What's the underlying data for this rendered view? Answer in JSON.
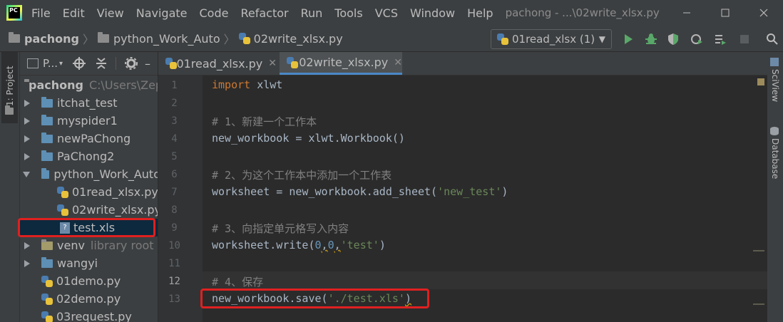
{
  "menubar": {
    "items": [
      "File",
      "Edit",
      "View",
      "Navigate",
      "Code",
      "Refactor",
      "Run",
      "Tools",
      "VCS",
      "Window",
      "Help"
    ],
    "title": "pachong - ...\\02write_xlsx.py"
  },
  "navbar": {
    "crumbs": [
      "pachong",
      "python_Work_Auto",
      "02write_xlsx.py"
    ],
    "run_config": "01read_xlsx (1)"
  },
  "left_strip": {
    "tab_label": "1: Project"
  },
  "right_strip": {
    "tabs": [
      "SciView",
      "Database"
    ]
  },
  "project_toolbar": {
    "label": "P..."
  },
  "tree": {
    "root": {
      "name": "pachong",
      "path": "C:\\Users\\Zep"
    },
    "items": [
      {
        "name": "itchat_test"
      },
      {
        "name": "myspider1"
      },
      {
        "name": "newPaChong"
      },
      {
        "name": "PaChong2"
      },
      {
        "name": "python_Work_Auto"
      },
      {
        "name": "01read_xlsx.py"
      },
      {
        "name": "02write_xlsx.py"
      },
      {
        "name": "test.xls"
      },
      {
        "name": "venv",
        "note": "library root"
      },
      {
        "name": "wangyi"
      },
      {
        "name": "01demo.py"
      },
      {
        "name": "02demo.py"
      },
      {
        "name": "03request.py"
      }
    ]
  },
  "tabs": [
    {
      "label": "01read_xlsx.py"
    },
    {
      "label": "02write_xlsx.py"
    }
  ],
  "code": {
    "line_numbers": [
      "1",
      "2",
      "3",
      "4",
      "5",
      "6",
      "7",
      "8",
      "9",
      "10",
      "11",
      "12",
      "13"
    ],
    "l1_kw": "import",
    "l1_rest": " xlwt",
    "l3": "# 1、新建一个工作本",
    "l4": "new_workbook = xlwt.Workbook()",
    "l6": "# 2、为这个工作本中添加一个工作表",
    "l7_a": "worksheet = new_workbook.add_sheet(",
    "l7_s": "'new_test'",
    "l7_b": ")",
    "l9": "# 3、向指定单元格写入内容",
    "l10_a": "worksheet.write(",
    "l10_n1": "0",
    "l10_c1": ",",
    "l10_n2": "0",
    "l10_c2": ",",
    "l10_s": "'test'",
    "l10_b": ")",
    "l12": "# 4、保存",
    "l13_a": "new_workbook.save(",
    "l13_s": "'./test.xls'",
    "l13_b": ")"
  },
  "colors": {
    "keyword": "#cc7832",
    "comment": "#808080",
    "string": "#6a8759",
    "number": "#6897bb",
    "highlight": "#e02020",
    "run_green": "#59a869"
  }
}
